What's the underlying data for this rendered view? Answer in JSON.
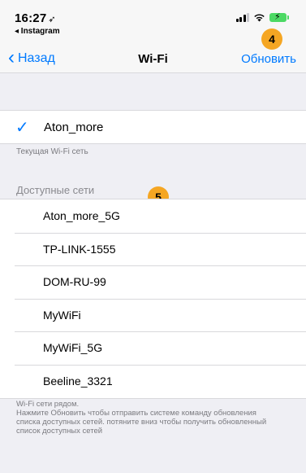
{
  "status_bar": {
    "time": "16:27",
    "location_icon": "location-arrow-icon",
    "back_app": "◂ Instagram",
    "signal_icon": "cellular-signal-icon",
    "wifi_icon": "wifi-icon",
    "battery_icon": "battery-charging-icon",
    "battery_color": "#4cd964"
  },
  "nav": {
    "back_label": "Назад",
    "title": "Wi-Fi",
    "refresh_label": "Обновить",
    "accent_color": "#007aff"
  },
  "badges": {
    "badge_4": "4",
    "badge_5": "5",
    "badge_color": "#f5a623"
  },
  "current": {
    "name": "Aton_more",
    "caption": "Текущая Wi-Fi сеть"
  },
  "available": {
    "header": "Доступные сети",
    "networks": [
      "Aton_more_5G",
      "TP-LINK-1555",
      "DOM-RU-99",
      "MyWiFi",
      "MyWiFi_5G",
      "Beeline_3321"
    ]
  },
  "footer": {
    "lines": [
      "Wi-Fi сети рядом.",
      "Нажмите Обновить чтобы отправить системе команду обновления",
      "списка доступных сетей. потяните вниз чтобы получить обновленный",
      "список доступных сетей"
    ]
  }
}
